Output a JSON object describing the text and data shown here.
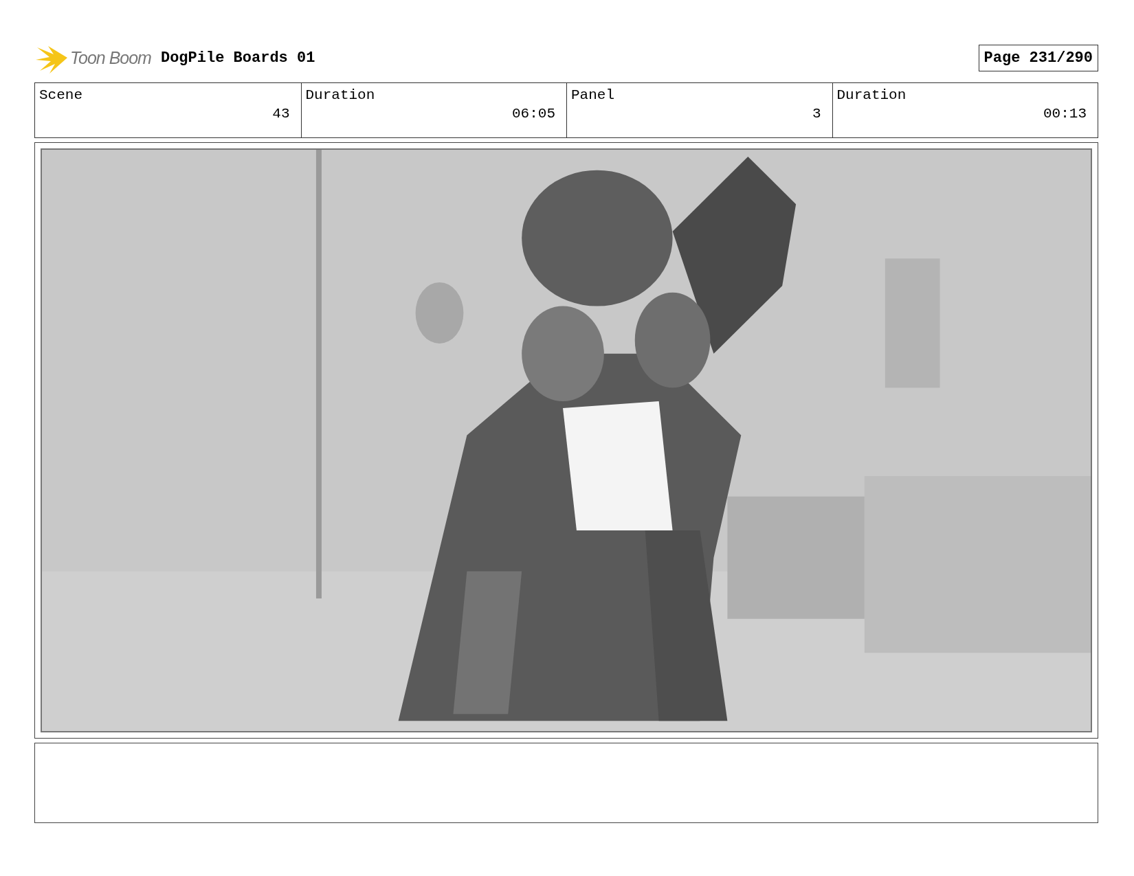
{
  "header": {
    "logo_text": "Toon Boom",
    "title": "DogPile Boards 01",
    "page": "Page 231/290"
  },
  "info": [
    {
      "label": "Scene",
      "value": "43"
    },
    {
      "label": "Duration",
      "value": "06:05"
    },
    {
      "label": "Panel",
      "value": "3"
    },
    {
      "label": "Duration",
      "value": "00:13"
    }
  ]
}
